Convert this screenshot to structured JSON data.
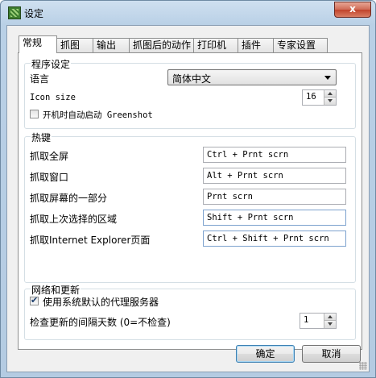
{
  "window": {
    "title": "设定",
    "close_glyph": "x"
  },
  "tabs": [
    "常规",
    "抓图",
    "输出",
    "抓图后的动作",
    "打印机",
    "插件",
    "专家设置"
  ],
  "program_settings": {
    "title": "程序设定",
    "language_label": "语言",
    "language_value": "简体中文",
    "icon_size_label": "Icon size",
    "icon_size_value": "16",
    "autostart_label": "开机时自动启动 Greenshot",
    "autostart_checked": false
  },
  "hotkeys": {
    "title": "热键",
    "rows": [
      {
        "label": "抓取全屏",
        "value": "Ctrl + Prnt scrn"
      },
      {
        "label": "抓取窗口",
        "value": "Alt + Prnt scrn"
      },
      {
        "label": "抓取屏幕的一部分",
        "value": "Prnt scrn"
      },
      {
        "label": "抓取上次选择的区域",
        "value": "Shift + Prnt scrn"
      },
      {
        "label": "抓取Internet Explorer页面",
        "value": "Ctrl + Shift + Prnt scrn"
      }
    ]
  },
  "network": {
    "title": "网络和更新",
    "proxy_label": "使用系统默认的代理服务器",
    "proxy_checked": true,
    "update_label": "检查更新的间隔天数 (0=不检查)",
    "update_value": "1"
  },
  "buttons": {
    "ok": "确定",
    "cancel": "取消"
  }
}
